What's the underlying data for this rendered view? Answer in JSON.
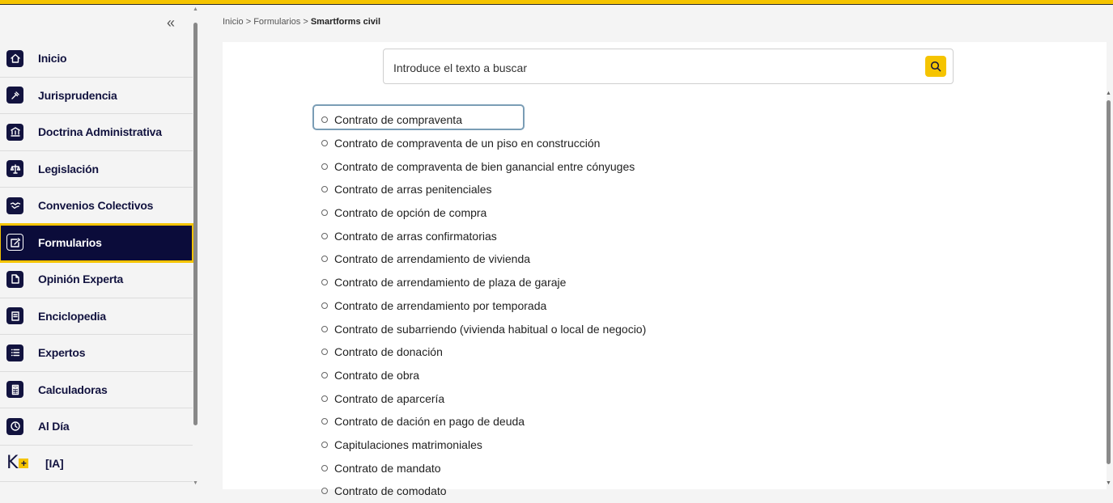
{
  "sidebar": {
    "collapse_glyph": "«",
    "items": [
      {
        "label": "Inicio",
        "icon": "home-icon"
      },
      {
        "label": "Jurisprudencia",
        "icon": "gavel-icon"
      },
      {
        "label": "Doctrina Administrativa",
        "icon": "bank-icon"
      },
      {
        "label": "Legislación",
        "icon": "scales-icon"
      },
      {
        "label": "Convenios Colectivos",
        "icon": "handshake-icon"
      },
      {
        "label": "Formularios",
        "icon": "form-edit-icon",
        "active": true
      },
      {
        "label": "Opinión Experta",
        "icon": "document-pen-icon"
      },
      {
        "label": "Enciclopedia",
        "icon": "book-icon"
      },
      {
        "label": "Expertos",
        "icon": "list-icon"
      },
      {
        "label": "Calculadoras",
        "icon": "calculator-icon"
      },
      {
        "label": "Al Día",
        "icon": "clock-icon"
      },
      {
        "label": "[IA]",
        "icon": "k-plus-logo"
      }
    ]
  },
  "breadcrumb": {
    "trail": "Inicio > Formularios > ",
    "current": "Smartforms civil"
  },
  "search": {
    "placeholder": "Introduce el texto a buscar",
    "button_icon": "search-icon"
  },
  "forms": [
    "Contrato de compraventa",
    "Contrato de compraventa de un piso en construcción",
    "Contrato de compraventa de bien ganancial entre cónyuges",
    "Contrato de arras penitenciales",
    "Contrato de opción de compra",
    "Contrato de arras confirmatorias",
    "Contrato de arrendamiento de vivienda",
    "Contrato de arrendamiento de plaza de garaje",
    "Contrato de arrendamiento por temporada",
    "Contrato de subarriendo (vivienda habitual o local de negocio)",
    "Contrato de donación",
    "Contrato de obra",
    "Contrato de aparcería",
    "Contrato de dación en pago de deuda",
    "Capitulaciones matrimoniales",
    "Contrato de mandato",
    "Contrato de comodato"
  ],
  "colors": {
    "accent": "#f5c400",
    "navy": "#0b0c3a",
    "focus": "#7a9db5"
  }
}
